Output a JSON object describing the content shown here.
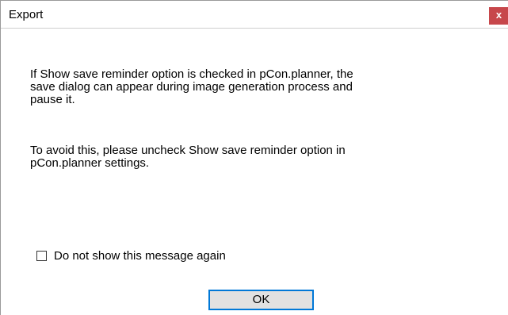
{
  "window": {
    "title": "Export",
    "close_label": "x"
  },
  "message": {
    "paragraph1": "If Show save reminder option is checked in pCon.planner, the\nsave dialog can appear during image generation process and\npause it.",
    "paragraph2": "To avoid this, please uncheck Show save reminder option in\npCon.planner settings."
  },
  "checkbox": {
    "label": "Do not show this message again",
    "checked": false
  },
  "buttons": {
    "ok_label": "OK"
  },
  "colors": {
    "close_button": "#c7474b",
    "focus_border": "#0078d7"
  }
}
